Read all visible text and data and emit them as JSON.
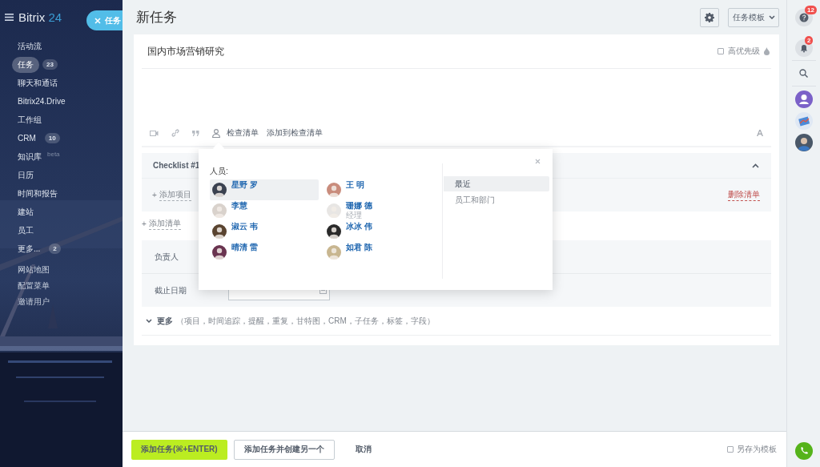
{
  "sidebar": {
    "logo": "Bitrix",
    "logo_number": "24",
    "close_tab": "任务",
    "items": [
      {
        "label": "活动流",
        "selected": false
      },
      {
        "label": "任务",
        "counter": "23",
        "selected": true
      },
      {
        "label": "聊天和通话",
        "selected": false
      },
      {
        "label": "Bitrix24.Drive",
        "selected": false
      },
      {
        "label": "工作组",
        "selected": false
      },
      {
        "label": "CRM",
        "counter": "10",
        "selected": false
      },
      {
        "label": "知识库",
        "sup": "beta",
        "selected": false
      },
      {
        "label": "日历",
        "selected": false
      },
      {
        "label": "时间和报告",
        "selected": false
      },
      {
        "label": "建站",
        "selected": false
      },
      {
        "label": "员工",
        "selected": false
      },
      {
        "label": "更多...",
        "counter": "2",
        "selected": false
      }
    ],
    "small_links": [
      "网站地图",
      "配置菜单",
      "邀请用户"
    ]
  },
  "header": {
    "title": "新任务",
    "template_button": "任务模板"
  },
  "task": {
    "title": "国内市场营销研究",
    "high_priority": {
      "label": "高优先级",
      "checked": false
    },
    "toolbar_links": [
      "检查清单",
      "添加到检查清单"
    ],
    "checklist": {
      "title": "Checklist #1",
      "expanded": true,
      "add_prefix": "+",
      "add_item": "添加项目",
      "delete": "删除清单"
    },
    "add_checklist_prefix": "+",
    "add_checklist": "添加清单",
    "fields": [
      {
        "label": "负责人",
        "kind": "text"
      },
      {
        "label": "截止日期",
        "kind": "date"
      }
    ],
    "more": {
      "label": "更多",
      "hint": "（项目，时间追踪，提醒，重复，甘特图，CRM，子任务，标签，字段）",
      "expanded": false
    }
  },
  "people_popup": {
    "label": "人员:",
    "people": [
      {
        "name": "星野 罗",
        "selected": true
      },
      {
        "name": "王 明",
        "selected": false
      },
      {
        "name": "李慧",
        "selected": false
      },
      {
        "name": "珊娜 德",
        "subtitle": "经理",
        "selected": false
      },
      {
        "name": "淑云 韦",
        "selected": false
      },
      {
        "name": "冰冰 伟",
        "selected": false
      },
      {
        "name": "晴清 雷",
        "selected": false
      },
      {
        "name": "如君 陈",
        "selected": false
      }
    ],
    "tabs": [
      {
        "label": "最近",
        "selected": true
      },
      {
        "label": "员工和部门",
        "selected": false
      }
    ]
  },
  "footer": {
    "buttons": [
      {
        "label": "添加任务(⌘+ENTER)",
        "kind": "primary"
      },
      {
        "label": "添加任务并创建另一个",
        "kind": "secondary"
      },
      {
        "label": "取消",
        "kind": "link"
      }
    ],
    "save_template": {
      "label": "另存为模板",
      "checked": false
    }
  },
  "right_bar": {
    "help_badge": "12",
    "bell_badge": "2"
  }
}
